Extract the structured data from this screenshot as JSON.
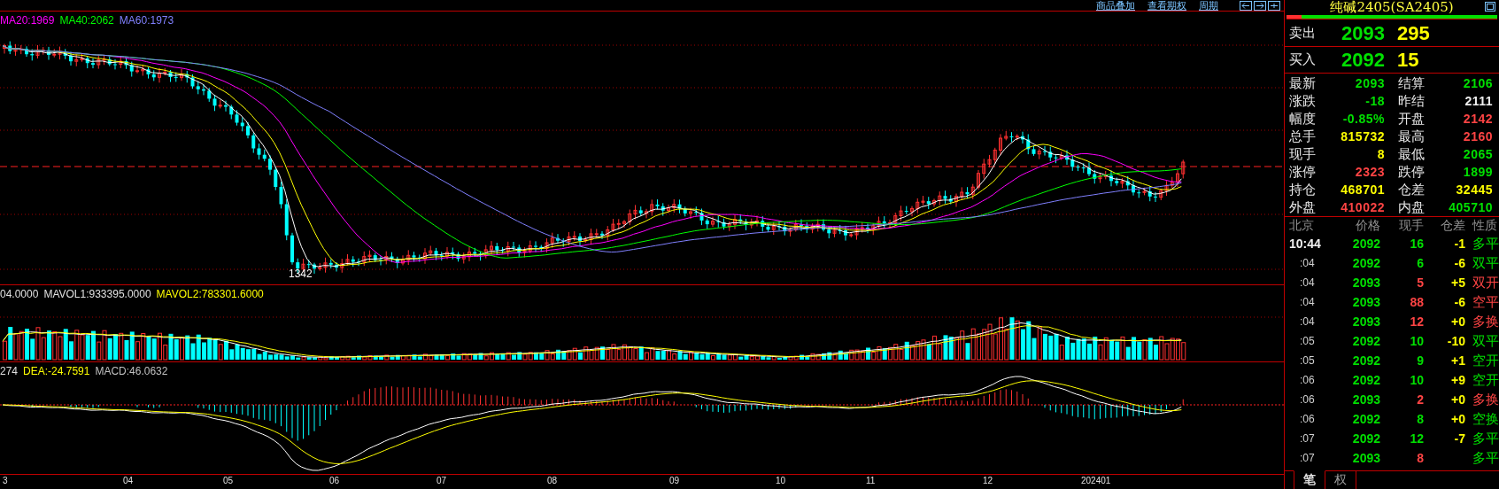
{
  "toolbar": {
    "links": [
      "商品叠加",
      "查看期权",
      "周期"
    ]
  },
  "chart": {
    "ma_labels": [
      {
        "text": "MA20:1969",
        "color": "#ff00ff"
      },
      {
        "text": "MA40:2062",
        "color": "#00ff00"
      },
      {
        "text": "MA60:1973",
        "color": "#8080ff"
      }
    ],
    "low_label": "1342",
    "volume_labels": [
      {
        "text": "04.0000",
        "color": "#e0e0e0"
      },
      {
        "text": "MAVOL1:933395.0000",
        "color": "#e0e0e0"
      },
      {
        "text": "MAVOL2:783301.6000",
        "color": "#ffff00"
      }
    ],
    "macd_labels": [
      {
        "text": "274",
        "color": "#e0e0e0"
      },
      {
        "text": "DEA:-24.7591",
        "color": "#ffff00"
      },
      {
        "text": "MACD:46.0632",
        "color": "#c0c0c0"
      }
    ],
    "x_axis": [
      "3",
      "04",
      "05",
      "06",
      "07",
      "08",
      "09",
      "10",
      "11",
      "12",
      "202401"
    ]
  },
  "quote": {
    "title": "纯碱2405(SA2405)",
    "ratio": {
      "level": 0.07
    },
    "ask": {
      "label": "卖出",
      "price": "2093",
      "volume": "295"
    },
    "bid": {
      "label": "买入",
      "price": "2092",
      "volume": "15"
    },
    "stats": [
      {
        "label": "最新",
        "value": "2093",
        "color": "#00e000"
      },
      {
        "label": "结算",
        "value": "2106",
        "color": "#00e000"
      },
      {
        "label": "涨跌",
        "value": "-18",
        "color": "#00e000"
      },
      {
        "label": "昨结",
        "value": "2111",
        "color": "#f0f0f0"
      },
      {
        "label": "幅度",
        "value": "-0.85%",
        "color": "#00e000"
      },
      {
        "label": "开盘",
        "value": "2142",
        "color": "#ff4444"
      },
      {
        "label": "总手",
        "value": "815732",
        "color": "#ffff00"
      },
      {
        "label": "最高",
        "value": "2160",
        "color": "#ff4444"
      },
      {
        "label": "现手",
        "value": "8",
        "color": "#ffff00"
      },
      {
        "label": "最低",
        "value": "2065",
        "color": "#00e000"
      },
      {
        "label": "涨停",
        "value": "2323",
        "color": "#ff4444"
      },
      {
        "label": "跌停",
        "value": "1899",
        "color": "#00e000"
      },
      {
        "label": "持仓",
        "value": "468701",
        "color": "#ffff00"
      },
      {
        "label": "仓差",
        "value": "32445",
        "color": "#ffff00"
      },
      {
        "label": "外盘",
        "value": "410022",
        "color": "#ff4444"
      },
      {
        "label": "内盘",
        "value": "405710",
        "color": "#00e000"
      }
    ],
    "trades_header": [
      "北京",
      "价格",
      "现手",
      "仓差",
      "性质"
    ],
    "trades": [
      {
        "kind": "full",
        "time": "10:44",
        "price": "2092",
        "volume": "16",
        "volume_up": false,
        "diff": "-1",
        "nature": "多平",
        "color": "#00e000"
      },
      {
        "kind": "short",
        "time": ":04",
        "price": "2092",
        "volume": "6",
        "volume_up": false,
        "diff": "-6",
        "nature": "双平",
        "color": "#00e000"
      },
      {
        "kind": "short",
        "time": ":04",
        "price": "2093",
        "volume": "5",
        "volume_up": true,
        "diff": "+5",
        "nature": "双开",
        "color": "#ff4444"
      },
      {
        "kind": "short",
        "time": ":04",
        "price": "2093",
        "volume": "88",
        "volume_up": true,
        "diff": "-6",
        "nature": "空平",
        "color": "#ff4444"
      },
      {
        "kind": "short",
        "time": ":04",
        "price": "2093",
        "volume": "12",
        "volume_up": true,
        "diff": "+0",
        "nature": "多换",
        "color": "#ff4444"
      },
      {
        "kind": "short",
        "time": ":05",
        "price": "2092",
        "volume": "10",
        "volume_up": false,
        "diff": "-10",
        "nature": "双平",
        "color": "#00e000"
      },
      {
        "kind": "short",
        "time": ":05",
        "price": "2092",
        "volume": "9",
        "volume_up": false,
        "diff": "+1",
        "nature": "空开",
        "color": "#00e000"
      },
      {
        "kind": "short",
        "time": ":06",
        "price": "2092",
        "volume": "10",
        "volume_up": false,
        "diff": "+9",
        "nature": "空开",
        "color": "#00e000"
      },
      {
        "kind": "short",
        "time": ":06",
        "price": "2093",
        "volume": "2",
        "volume_up": true,
        "diff": "+0",
        "nature": "多换",
        "color": "#ff4444"
      },
      {
        "kind": "short",
        "time": ":06",
        "price": "2092",
        "volume": "8",
        "volume_up": false,
        "diff": "+0",
        "nature": "空换",
        "color": "#00e000"
      },
      {
        "kind": "short",
        "time": ":07",
        "price": "2092",
        "volume": "12",
        "volume_up": false,
        "diff": "-7",
        "nature": "多平",
        "color": "#00e000"
      },
      {
        "kind": "short",
        "time": ":07",
        "price": "2093",
        "volume": "8",
        "volume_up": true,
        "nature": "多平",
        "color": "#00e000"
      }
    ],
    "tabs": [
      {
        "label": "笔",
        "selected": true
      },
      {
        "label": "权",
        "selected": false
      }
    ]
  }
}
